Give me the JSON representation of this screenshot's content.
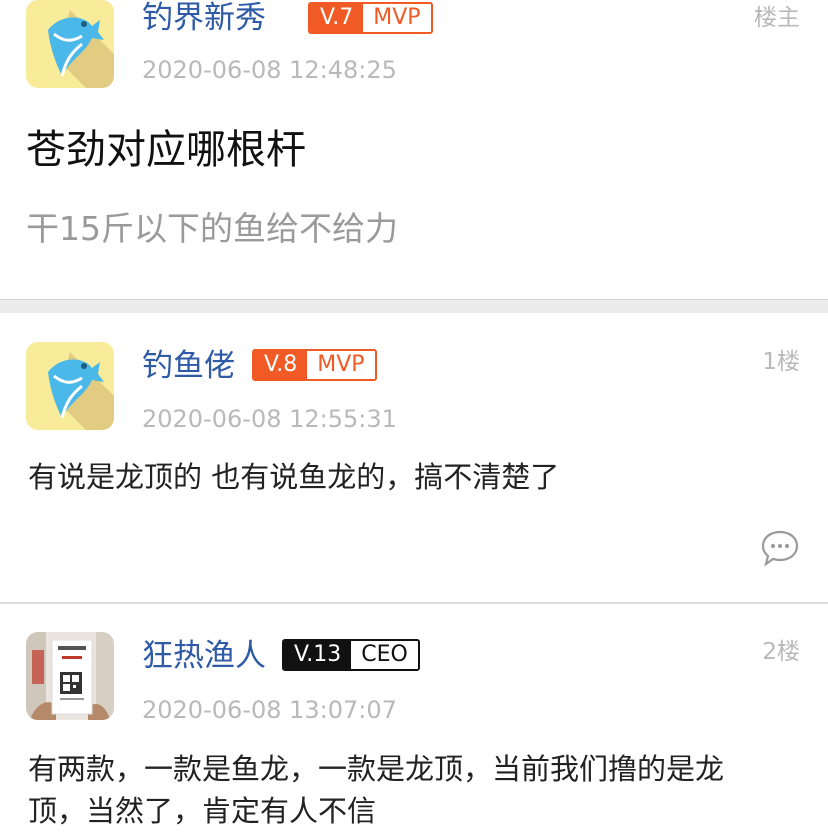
{
  "original_post": {
    "username": "钓界新秀",
    "level": "V.7",
    "title": "MVP",
    "timestamp": "2020-06-08 12:48:25",
    "floor": "楼主",
    "post_title": "苍劲对应哪根杆",
    "post_body": "干15斤以下的鱼给不给力"
  },
  "replies": [
    {
      "username": "钓鱼佬",
      "level": "V.8",
      "title": "MVP",
      "timestamp": "2020-06-08 12:55:31",
      "floor": "1楼",
      "text": "有说是龙顶的 也有说鱼龙的，搞不清楚了"
    },
    {
      "username": "狂热渔人",
      "level": "V.13",
      "title": "CEO",
      "timestamp": "2020-06-08 13:07:07",
      "floor": "2楼",
      "text_line1": "有两款，一款是鱼龙，一款是龙顶，当前我们撸的是龙",
      "text_line2": "顶，当然了，肯定有人不信"
    }
  ],
  "colors": {
    "username": "#2e5aa6",
    "badge_orange": "#f15a24",
    "badge_black": "#111111",
    "meta_gray": "#b9b9b9",
    "avatar_bg": "#f8ec9a",
    "fish_blue": "#4ab8e8"
  },
  "icons": [
    "fish-avatar-icon",
    "comment-bubble-icon"
  ]
}
